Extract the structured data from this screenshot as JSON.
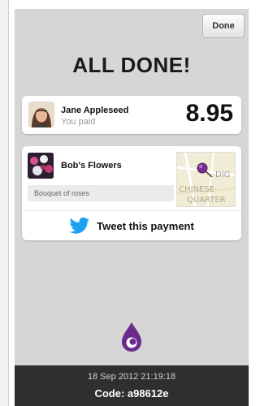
{
  "header": {
    "done_label": "Done"
  },
  "main": {
    "title": "ALL DONE!"
  },
  "payment": {
    "payer_name": "Jane Appleseed",
    "payer_subtitle": "You paid",
    "amount": "8.95"
  },
  "merchant": {
    "name": "Bob's Flowers",
    "note": "Bouquet of roses",
    "map_labels": [
      "DIG",
      "CHINESE",
      "QUARTER"
    ]
  },
  "tweet": {
    "label": "Tweet this payment"
  },
  "footer": {
    "timestamp": "18 Sep 2012 21:19:18",
    "code": "Code: a98612e"
  },
  "colors": {
    "screen_bg": "#d6d6d6",
    "footer_bg": "#2f2f2f",
    "twitter_blue": "#1da1f2",
    "brand_purple": "#6b2a8c"
  },
  "icons": {
    "tweet": "twitter-bird-icon",
    "logo": "purple-drop-logo",
    "map_pin": "map-pin-icon"
  }
}
